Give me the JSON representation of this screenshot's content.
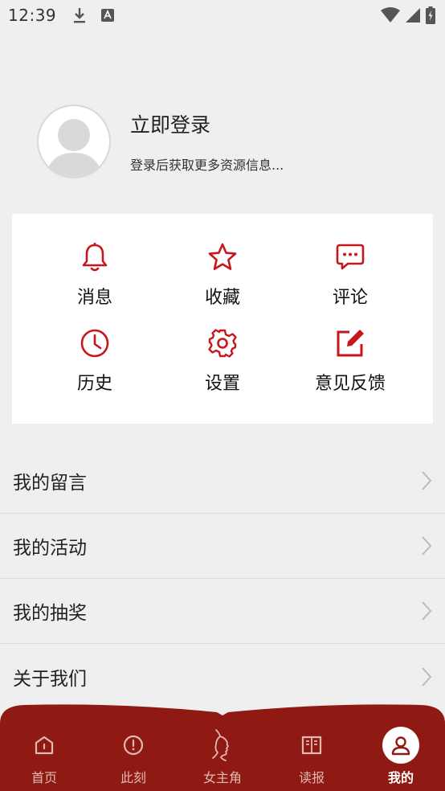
{
  "status_bar": {
    "time": "12:39",
    "icons": [
      "download-icon",
      "text-a-icon",
      "wifi-icon",
      "signal-icon",
      "battery-icon"
    ]
  },
  "profile": {
    "title": "立即登录",
    "subtitle": "登录后获取更多资源信息..."
  },
  "grid": [
    {
      "label": "消息",
      "icon": "bell-icon"
    },
    {
      "label": "收藏",
      "icon": "star-icon"
    },
    {
      "label": "评论",
      "icon": "comment-icon"
    },
    {
      "label": "历史",
      "icon": "clock-icon"
    },
    {
      "label": "设置",
      "icon": "gear-icon"
    },
    {
      "label": "意见反馈",
      "icon": "edit-icon"
    }
  ],
  "list": [
    {
      "label": "我的留言"
    },
    {
      "label": "我的活动"
    },
    {
      "label": "我的抽奖"
    },
    {
      "label": "关于我们"
    }
  ],
  "bottom_nav": [
    {
      "label": "首页",
      "icon": "home-icon"
    },
    {
      "label": "此刻",
      "icon": "clock-alert-icon"
    },
    {
      "label": "女主角",
      "icon": "profile-silhouette-icon"
    },
    {
      "label": "读报",
      "icon": "book-icon"
    },
    {
      "label": "我的",
      "icon": "user-icon",
      "active": true
    }
  ],
  "colors": {
    "accent": "#c8161d",
    "nav_bg": "#8e1a13",
    "page_bg": "#efefef"
  }
}
